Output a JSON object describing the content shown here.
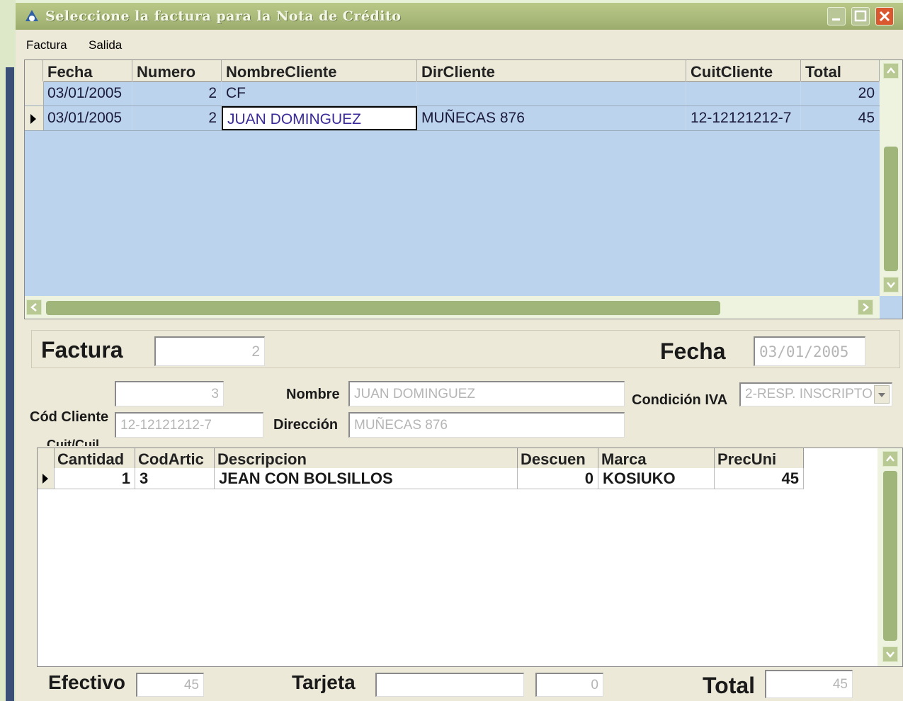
{
  "window": {
    "title": "Seleccione la factura para la Nota de Crédito",
    "accent": "#a9b97a",
    "grid_selection_color": "#bcd3ee"
  },
  "menu": {
    "items": [
      "Factura",
      "Salida"
    ]
  },
  "invoices_grid": {
    "columns": [
      "Fecha",
      "Numero",
      "NombreCliente",
      "DirCliente",
      "CuitCliente",
      "Total"
    ],
    "rows": [
      {
        "fecha": "03/01/2005",
        "numero": "2",
        "nombre": "CF",
        "dir": "",
        "cuit": "",
        "total": "20"
      },
      {
        "fecha": "03/01/2005",
        "numero": "2",
        "nombre": "JUAN DOMINGUEZ",
        "dir": "MUÑECAS 876",
        "cuit": "12-12121212-7",
        "total": "45"
      }
    ]
  },
  "form": {
    "factura_label": "Factura",
    "factura_value": "2",
    "fecha_label": "Fecha",
    "fecha_value": "03/01/2005",
    "cod_cliente_value": "3",
    "cod_cliente_label": "Cód Cliente",
    "cuit_value": "12-12121212-7",
    "cuit_label": "Cuit/Cuil",
    "nombre_label": "Nombre",
    "nombre_value": "JUAN DOMINGUEZ",
    "direccion_label": "Dirección",
    "direccion_value": "MUÑECAS 876",
    "condicion_iva_label": "Condición IVA",
    "condicion_iva_value": "2-RESP. INSCRIPTO"
  },
  "items_grid": {
    "columns": [
      "Cantidad",
      "CodArtic",
      "Descripcion",
      "Descuen",
      "Marca",
      "PrecUni"
    ],
    "rows": [
      {
        "cantidad": "1",
        "codartic": "3",
        "descripcion": "JEAN CON BOLSILLOS",
        "descuento": "0",
        "marca": "KOSIUKO",
        "precuni": "45"
      }
    ]
  },
  "footer": {
    "efectivo_label": "Efectivo",
    "efectivo_value": "45",
    "tarjeta_label": "Tarjeta",
    "tarjeta_value": "",
    "tarjeta_amount": "0",
    "total_label": "Total",
    "total_value": "45"
  }
}
